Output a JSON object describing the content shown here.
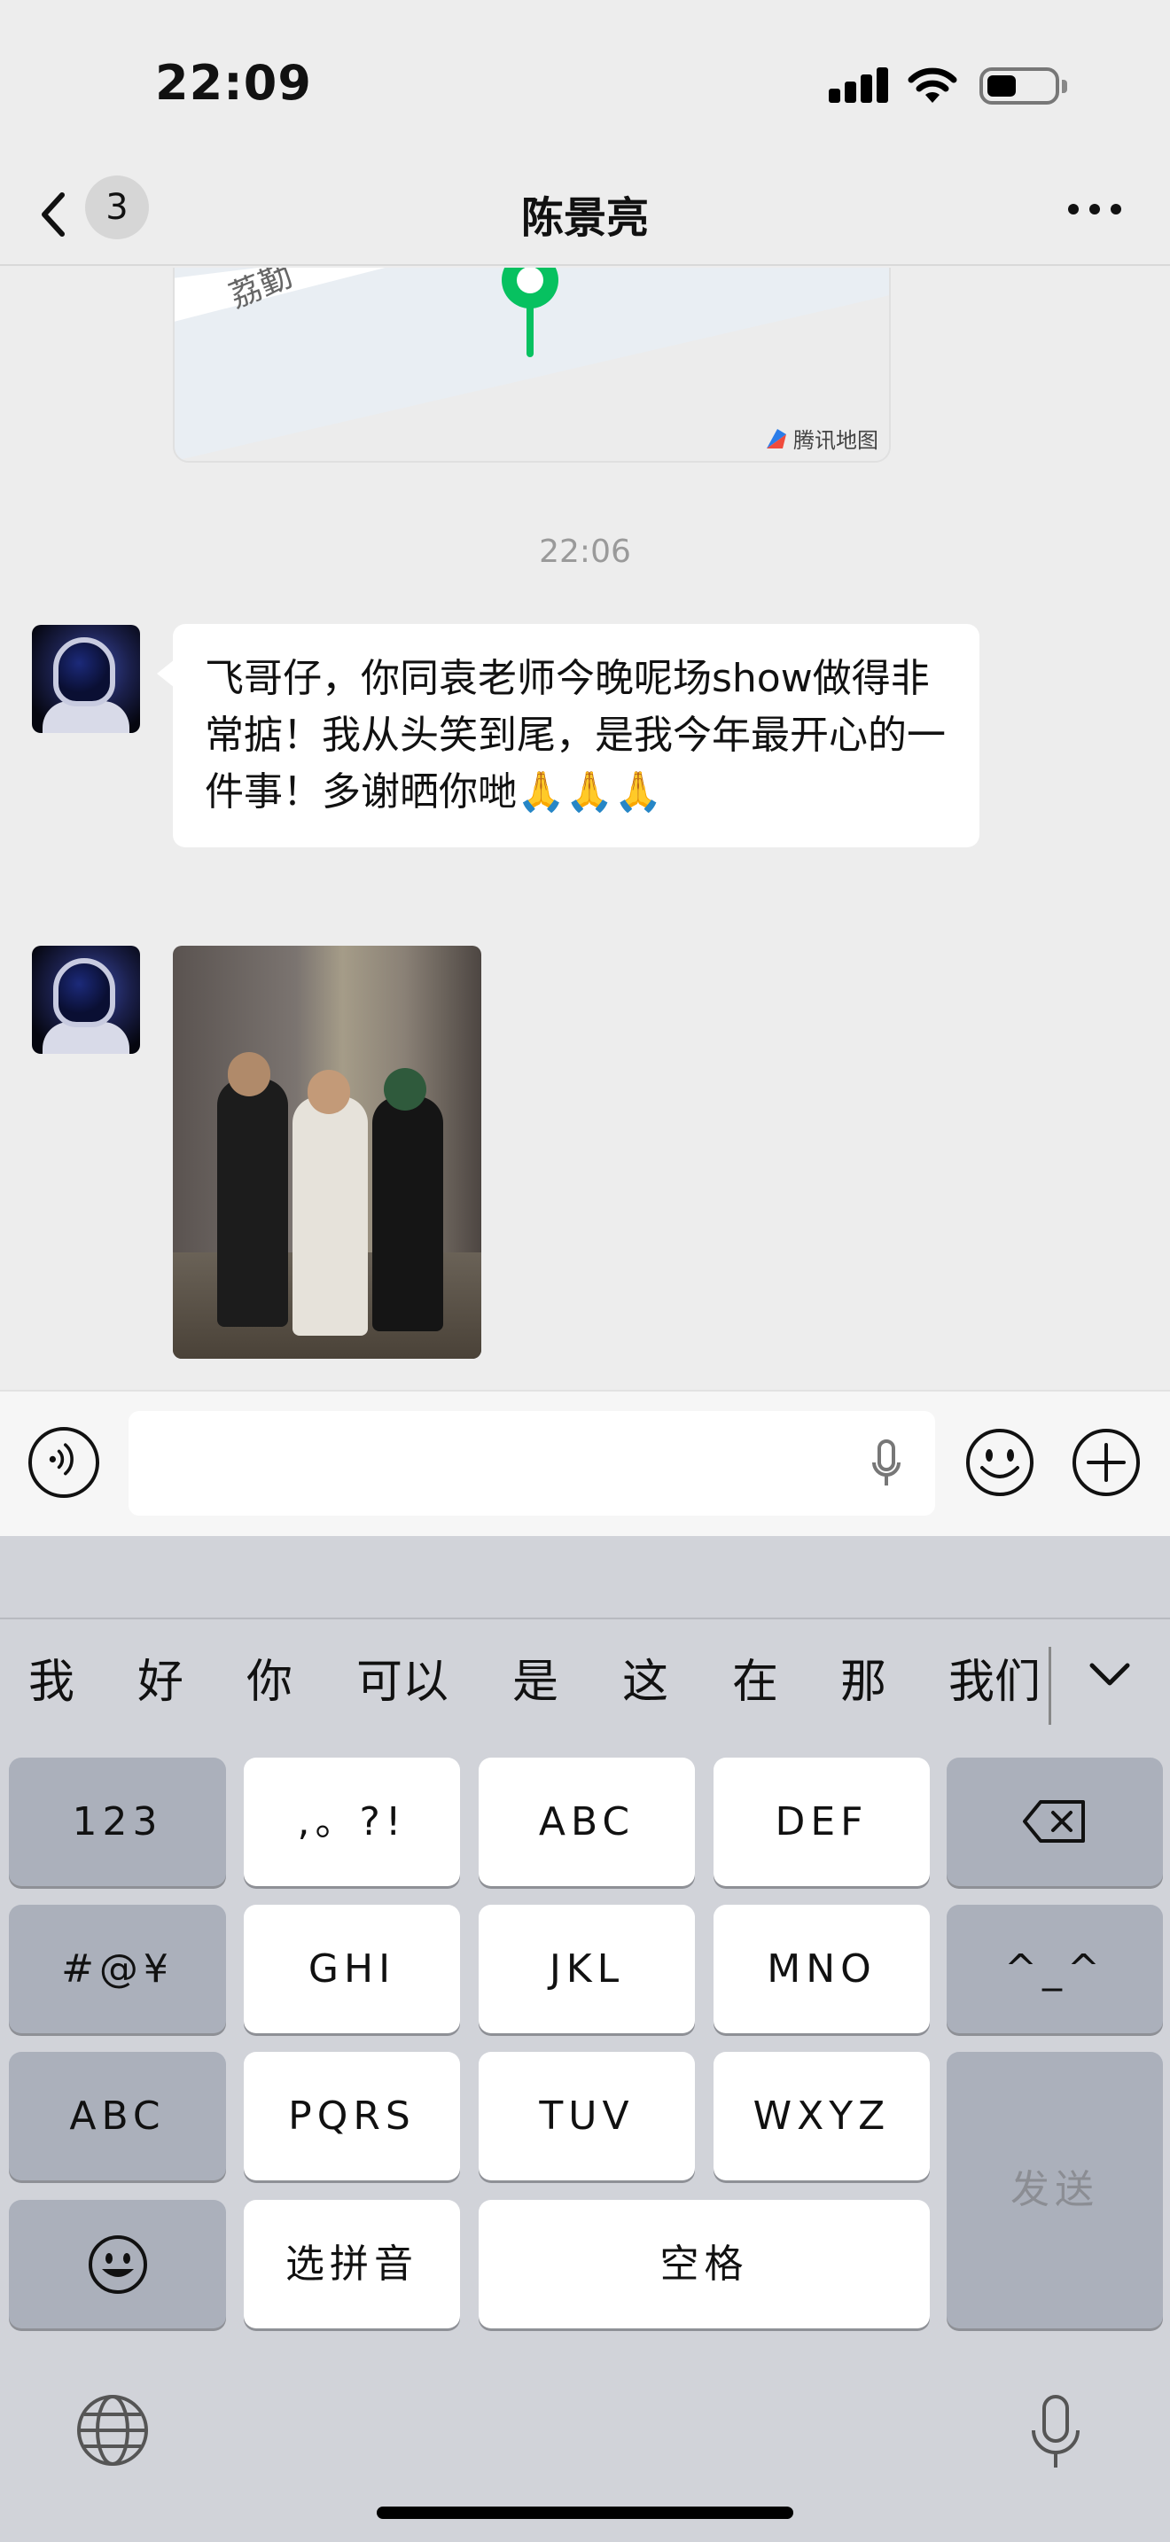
{
  "status_bar": {
    "time": "22:09"
  },
  "nav": {
    "unread_count": "3",
    "title": "陈景亮"
  },
  "chat": {
    "map_road_label": "荔勤",
    "map_brand": "腾讯地图",
    "timestamp": "22:06",
    "message_text": "飞哥仔，你同袁老师今晚呢场show做得非常掂！我从头笑到尾，是我今年最开心的一件事！多谢晒你哋🙏🙏🙏"
  },
  "input": {
    "value": ""
  },
  "keyboard": {
    "candidates": [
      "我",
      "好",
      "你",
      "可以",
      "是",
      "这",
      "在",
      "那",
      "我们"
    ],
    "keys": {
      "num": "123",
      "punct": ",。?!",
      "abc": "ABC",
      "def": "DEF",
      "symbols": "#@¥",
      "ghi": "GHI",
      "jkl": "JKL",
      "mno": "MNO",
      "emoticon": "^_^",
      "abc_switch": "ABC",
      "pqrs": "PQRS",
      "tuv": "TUV",
      "wxyz": "WXYZ",
      "send": "发送",
      "pinyin": "选拼音",
      "space": "空格"
    }
  },
  "colors": {
    "accent_green": "#07c160",
    "bubble": "#ffffff",
    "background": "#ededed"
  },
  "icons": [
    "back-chevron-icon",
    "more-icon",
    "location-pin-icon",
    "voice-icon",
    "microphone-icon",
    "emoji-icon",
    "plus-icon",
    "backspace-icon",
    "globe-icon"
  ]
}
